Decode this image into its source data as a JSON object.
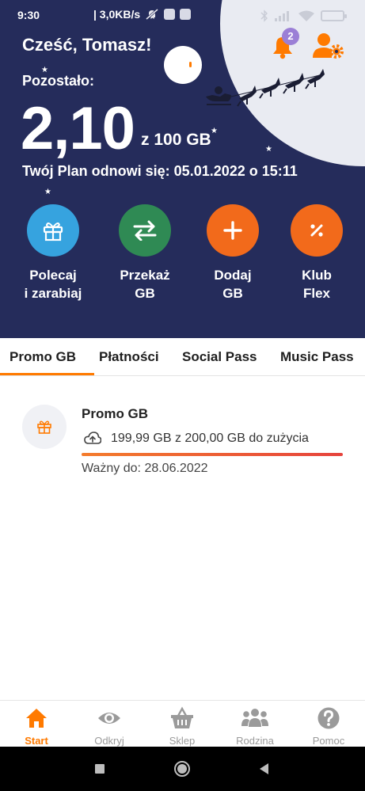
{
  "status_bar": {
    "time": "9:30",
    "network_speed": "| 3,0KB/s"
  },
  "header": {
    "greeting": "Cześć, Tomasz!",
    "remaining_label": "Pozostało:",
    "remaining_value": "2,10",
    "remaining_total": "z 100 GB",
    "renew_text": "Twój Plan odnowi się: 05.01.2022 o 15:11",
    "notification_count": "2"
  },
  "actions": [
    {
      "label": "Polecaj\ni zarabiaj",
      "icon": "gift-icon",
      "color": "#36a3df"
    },
    {
      "label": "Przekaż\nGB",
      "icon": "transfer-arrows-icon",
      "color": "#2f8a54"
    },
    {
      "label": "Dodaj\nGB",
      "icon": "plus-icon",
      "color": "#f26a1b"
    },
    {
      "label": "Klub\nFlex",
      "icon": "percent-icon",
      "color": "#f26a1b"
    }
  ],
  "tabs": [
    {
      "label": "Promo GB",
      "active": true
    },
    {
      "label": "Płatności",
      "active": false
    },
    {
      "label": "Social Pass",
      "active": false
    },
    {
      "label": "Music Pass",
      "active": false
    }
  ],
  "promo": {
    "title": "Promo GB",
    "usage": "199,99 GB z 200,00 GB do zużycia",
    "progress": 0.99995,
    "valid_until": "Ważny do: 28.06.2022"
  },
  "bottom_nav": [
    {
      "label": "Start",
      "icon": "home-icon",
      "active": true
    },
    {
      "label": "Odkryj",
      "icon": "eye-icon",
      "active": false
    },
    {
      "label": "Sklep",
      "icon": "basket-icon",
      "active": false
    },
    {
      "label": "Rodzina",
      "icon": "family-icon",
      "active": false
    },
    {
      "label": "Pomoc",
      "icon": "help-icon",
      "active": false
    }
  ],
  "colors": {
    "header_bg": "#252c5b",
    "accent": "#ff7a00",
    "badge": "#9b7fd6"
  }
}
